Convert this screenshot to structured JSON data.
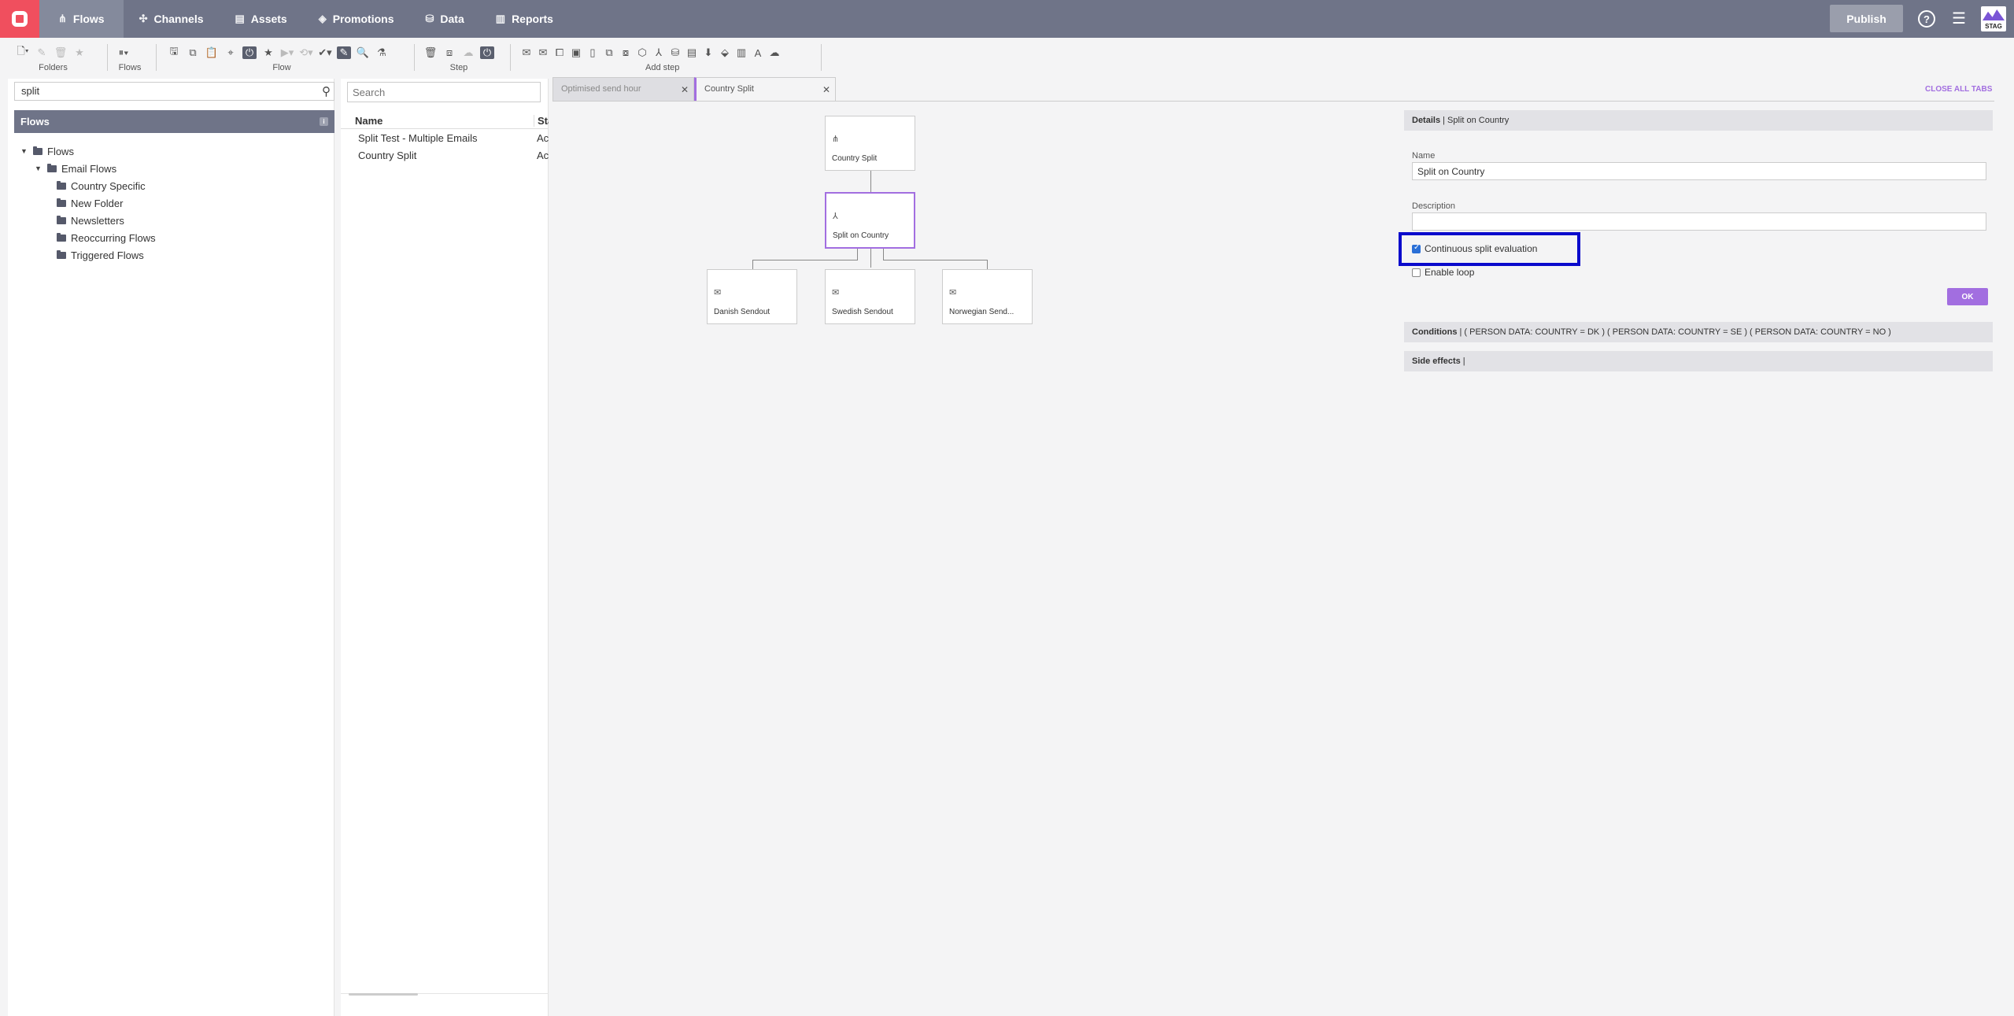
{
  "topbar": {
    "nav": [
      {
        "label": "Flows",
        "icon": "flows-icon"
      },
      {
        "label": "Channels",
        "icon": "channels-icon"
      },
      {
        "label": "Assets",
        "icon": "assets-icon"
      },
      {
        "label": "Promotions",
        "icon": "promotions-icon"
      },
      {
        "label": "Data",
        "icon": "data-icon"
      },
      {
        "label": "Reports",
        "icon": "reports-icon"
      }
    ],
    "publish_label": "Publish",
    "env_badge": "STAG"
  },
  "toolbar": {
    "groups": [
      "Folders",
      "Flows",
      "Flow",
      "Step",
      "Add step"
    ]
  },
  "left": {
    "search_value": "split",
    "header": "Flows",
    "info_badge": "i",
    "tree": [
      "Flows",
      "Email Flows",
      "Country Specific",
      "New Folder",
      "Newsletters",
      "Reoccurring Flows",
      "Triggered Flows"
    ]
  },
  "mid": {
    "search_placeholder": "Search",
    "col_name": "Name",
    "col_status": "Sta",
    "rows": [
      {
        "name": "Split Test - Multiple Emails",
        "status": "Ac"
      },
      {
        "name": "Country Split",
        "status": "Ac"
      }
    ]
  },
  "tabs": [
    {
      "label": "Optimised send hour"
    },
    {
      "label": "Country Split"
    }
  ],
  "close_all": "CLOSE ALL TABS",
  "canvas": {
    "nodes": [
      {
        "label": "Country Split"
      },
      {
        "label": "Split on Country"
      },
      {
        "label": "Danish Sendout"
      },
      {
        "label": "Swedish Sendout"
      },
      {
        "label": "Norwegian Send..."
      }
    ]
  },
  "details": {
    "header_bold": "Details",
    "header_rest": " | Split on Country",
    "name_label": "Name",
    "name_value": "Split on Country",
    "desc_label": "Description",
    "desc_value": "",
    "continuous_label": "Continuous split evaluation",
    "continuous_checked": true,
    "loop_label": "Enable loop",
    "loop_checked": false,
    "ok_label": "OK",
    "conditions_bold": "Conditions",
    "conditions_rest": " | ( PERSON DATA: COUNTRY = DK ) ( PERSON DATA: COUNTRY = SE ) ( PERSON DATA: COUNTRY = NO )",
    "side_bold": "Side effects",
    "side_rest": " |"
  },
  "colors": {
    "topbar": "#6f7488",
    "accent": "#a26ee0",
    "logo": "#f04f5e",
    "highlight": "#0a0acc"
  }
}
